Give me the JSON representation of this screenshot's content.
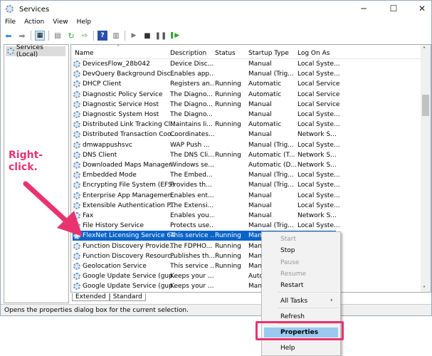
{
  "window": {
    "title": "Services",
    "controls": [
      "minimize",
      "maximize",
      "close"
    ]
  },
  "menubar": [
    "File",
    "Action",
    "View",
    "Help"
  ],
  "toolbar": [
    "back-icon",
    "forward-icon",
    "show-tree-icon",
    "properties-icon",
    "refresh-icon",
    "export-icon",
    "help-icon",
    "console-icon",
    "play-icon",
    "stop-icon",
    "pause-icon",
    "resume-icon"
  ],
  "tree": {
    "selected": "Services (Local)"
  },
  "columns": [
    "Name",
    "Description",
    "Status",
    "Startup Type",
    "Log On As"
  ],
  "rows": [
    [
      "DevicesFlow_28b042",
      "Device Disc...",
      "",
      "Manual",
      "Local Syste..."
    ],
    [
      "DevQuery Background Disc...",
      "Enables app...",
      "",
      "Manual (Trig...",
      "Local Syste..."
    ],
    [
      "DHCP Client",
      "Registers an...",
      "Running",
      "Automatic",
      "Local Service"
    ],
    [
      "Diagnostic Policy Service",
      "The Diagno...",
      "Running",
      "Automatic",
      "Local Service"
    ],
    [
      "Diagnostic Service Host",
      "The Diagno...",
      "Running",
      "Manual",
      "Local Service"
    ],
    [
      "Diagnostic System Host",
      "The Diagno...",
      "",
      "Manual",
      "Local Syste..."
    ],
    [
      "Distributed Link Tracking Cl...",
      "Maintains li...",
      "Running",
      "Automatic",
      "Local Syste..."
    ],
    [
      "Distributed Transaction Coo...",
      "Coordinates...",
      "",
      "Manual",
      "Network S..."
    ],
    [
      "dmwappushsvc",
      "WAP Push ...",
      "",
      "Manual (Trig...",
      "Local Syste..."
    ],
    [
      "DNS Client",
      "The DNS Cli...",
      "Running",
      "Automatic (T...",
      "Network S..."
    ],
    [
      "Downloaded Maps Manager",
      "Windows se...",
      "",
      "Automatic (D...",
      "Network S..."
    ],
    [
      "Embedded Mode",
      "The Embed...",
      "",
      "Manual (Trig...",
      "Local Syste..."
    ],
    [
      "Encrypting File System (EFS)",
      "Provides th...",
      "",
      "Manual (Trig...",
      "Local Syste..."
    ],
    [
      "Enterprise App Managemen...",
      "Enables ent...",
      "",
      "Manual",
      "Local Syste..."
    ],
    [
      "Extensible Authentication P...",
      "The Extensi...",
      "",
      "Manual",
      "Local Syste..."
    ],
    [
      "Fax",
      "Enables you...",
      "",
      "Manual",
      "Network S..."
    ],
    [
      "File History Service",
      "Protects use...",
      "",
      "Manual (Trig...",
      "Local Syste..."
    ],
    [
      "FlexNet Licensing Service 64",
      "This service ...",
      "Running",
      "Manual",
      ""
    ],
    [
      "Function Discovery Provide...",
      "The FDPHO...",
      "Running",
      "Manual",
      ""
    ],
    [
      "Function Discovery Resourc...",
      "Publishes th...",
      "Running",
      "Manual",
      ""
    ],
    [
      "Geolocation Service",
      "This service ...",
      "Running",
      "Manual",
      ""
    ],
    [
      "Google Update Service (gup...",
      "Keeps your ...",
      "",
      "Automatic",
      ""
    ],
    [
      "Google Update Service (gup...",
      "Keeps your ...",
      "",
      "Manual",
      ""
    ]
  ],
  "selected_row": 17,
  "tabs": [
    "Extended",
    "Standard"
  ],
  "status": "Opens the properties dialog box for the current selection.",
  "context_menu": {
    "start": "Start",
    "stop": "Stop",
    "pause": "Pause",
    "resume": "Resume",
    "restart": "Restart",
    "all_tasks": "All Tasks",
    "refresh": "Refresh",
    "properties": "Properties",
    "help": "Help"
  },
  "annotation": {
    "line1": "Right-",
    "line2": "click."
  },
  "colors": {
    "accent": "#e8336e",
    "selection": "#0a64c8"
  }
}
